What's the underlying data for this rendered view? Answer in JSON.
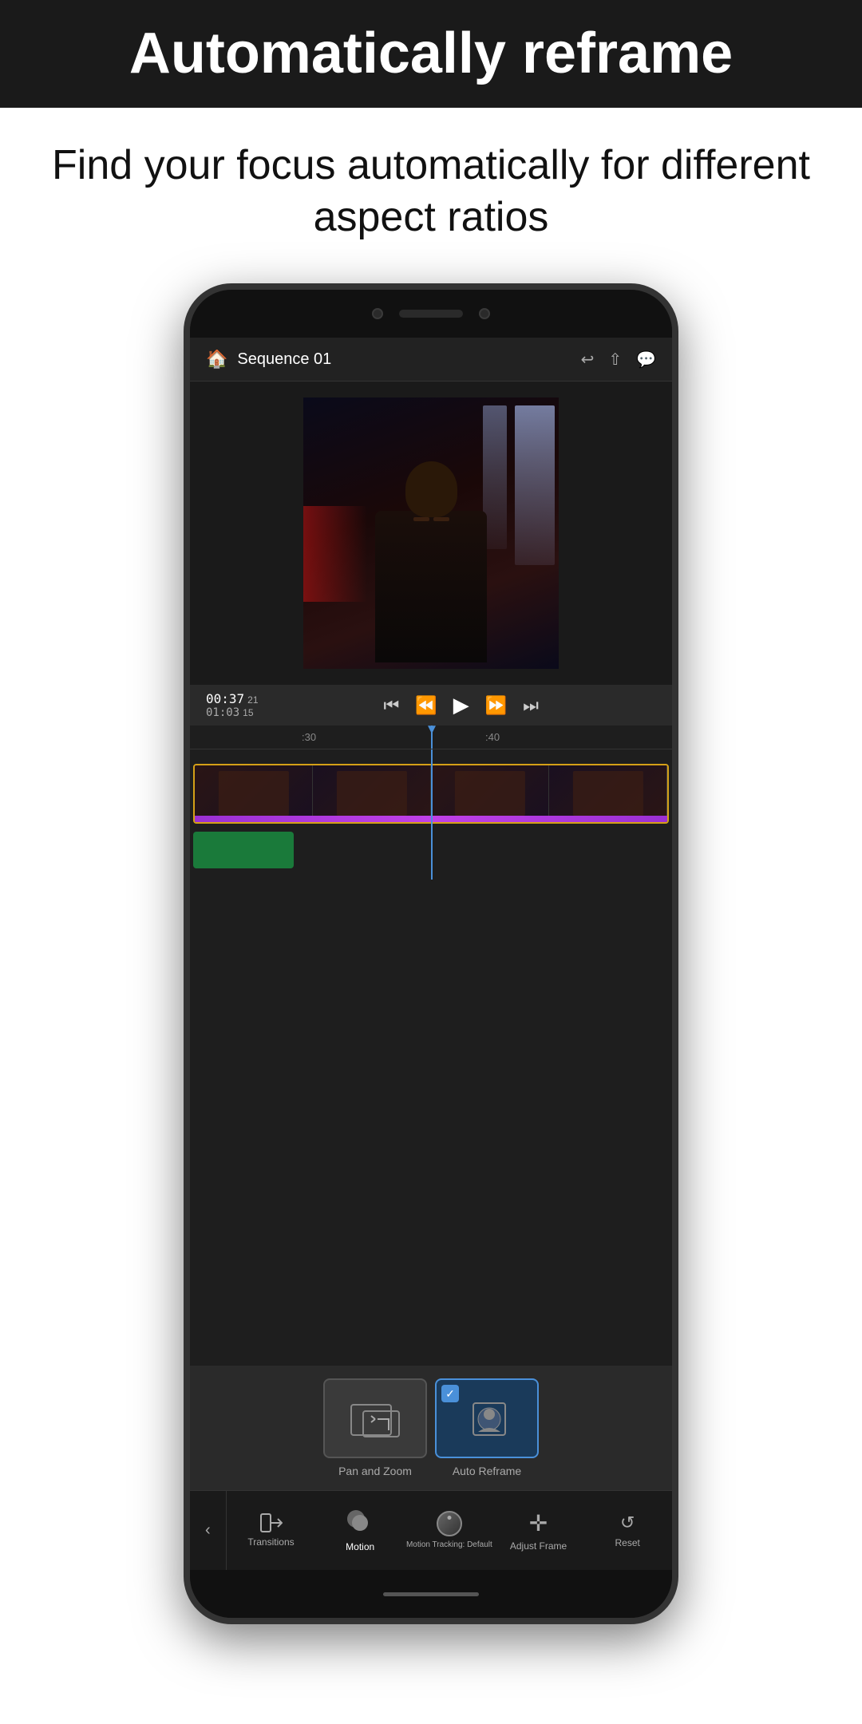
{
  "header": {
    "banner_bg": "#1a1a1a",
    "title": "Automatically reframe",
    "subtitle": "Find your focus automatically for different aspect ratios"
  },
  "phone": {
    "top_bar": {
      "sequence_name": "Sequence 01",
      "icons": [
        "undo",
        "share",
        "chat"
      ]
    },
    "timecode": {
      "current": "00:37",
      "current_frames": "21",
      "total": "01:03",
      "total_frames": "15"
    },
    "timeline": {
      "mark1": ":30",
      "mark2": ":40"
    },
    "effects": {
      "pan_zoom_label": "Pan and Zoom",
      "auto_reframe_label": "Auto Reframe"
    },
    "toolbar": {
      "back_label": "<",
      "transitions_label": "Transitions",
      "motion_label": "Motion",
      "motion_tracking_label": "Motion Tracking: Default",
      "adjust_frame_label": "Adjust Frame",
      "reset_label": "Reset"
    }
  }
}
